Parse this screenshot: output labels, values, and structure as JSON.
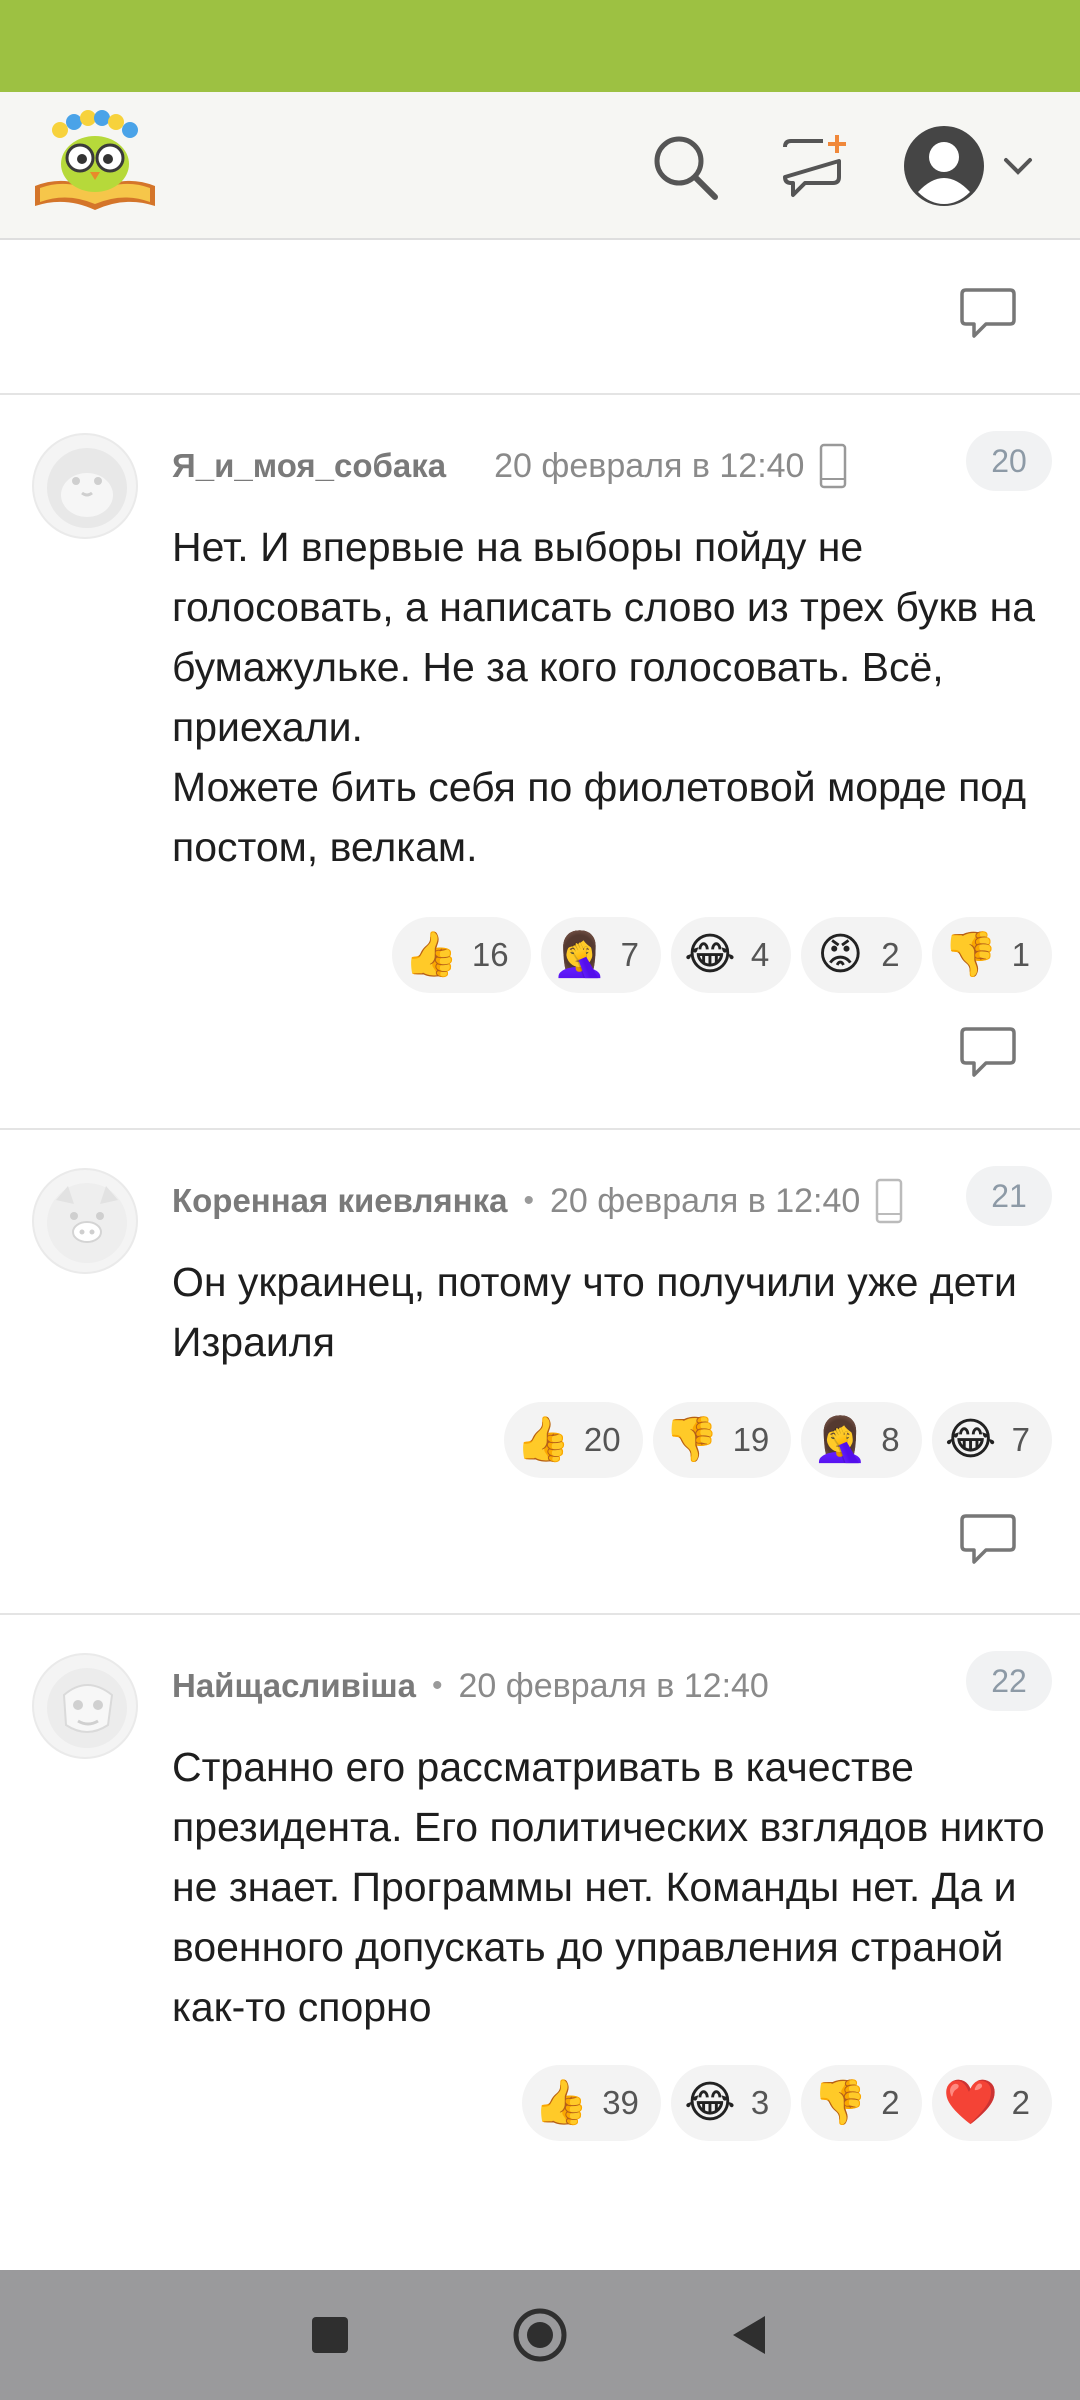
{
  "colors": {
    "status_bar": "#9dc142",
    "app_bar": "#f6f6f3",
    "nav_bar": "#9a9a9c",
    "reaction_bg": "#f3f3f3"
  },
  "header": {
    "logo_icon": "owl-on-book-logo",
    "search_icon": "search-icon",
    "new_post_icon": "new-post-icon",
    "profile_icon": "user-avatar-icon"
  },
  "comments": [
    {
      "number": "20",
      "author": "Я_и_моя_собака",
      "separator": "",
      "date": "20 февраля в 12:40",
      "device": "phone",
      "text": "Нет. И впервые на выборы пойду не голосовать, а написать слово из трех букв на бумажульке. Не за кого голосовать. Всё, приехали.\nМожете бить себя по фиолетовой морде под постом, велкам.",
      "reactions": [
        {
          "emoji": "👍",
          "count": "16"
        },
        {
          "emoji": "🤦‍♀️",
          "count": "7"
        },
        {
          "emoji": "😂",
          "count": "4"
        },
        {
          "emoji": "😡",
          "count": "2"
        },
        {
          "emoji": "👎",
          "count": "1"
        }
      ]
    },
    {
      "number": "21",
      "author": "Коренная киевлянка",
      "separator": "•",
      "date": "20 февраля в 12:40",
      "device": "phone",
      "text": "Он украинец, потому что получили уже дети Израиля",
      "reactions": [
        {
          "emoji": "👍",
          "count": "20"
        },
        {
          "emoji": "👎",
          "count": "19"
        },
        {
          "emoji": "🤦‍♀️",
          "count": "8"
        },
        {
          "emoji": "😂",
          "count": "7"
        }
      ]
    },
    {
      "number": "22",
      "author": "Найщасливіша",
      "separator": "•",
      "date": "20 февраля в 12:40",
      "device": "",
      "text": "Странно его рассматривать в качестве президента. Его политических взглядов никто не знает. Программы нет. Команды нет. Да и военного допускать до управления страной как-то спорно",
      "reactions": [
        {
          "emoji": "👍",
          "count": "39"
        },
        {
          "emoji": "😂",
          "count": "3"
        },
        {
          "emoji": "👎",
          "count": "2"
        },
        {
          "emoji": "❤️",
          "count": "2"
        }
      ]
    }
  ],
  "navbar": {
    "recents_icon": "square-recents-icon",
    "home_icon": "circle-home-icon",
    "back_icon": "triangle-back-icon"
  }
}
